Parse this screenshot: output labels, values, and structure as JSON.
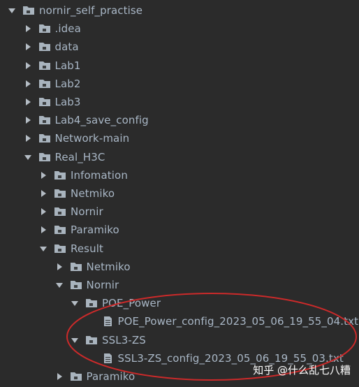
{
  "tree": [
    {
      "label": "nornir_self_practise",
      "type": "folder",
      "expanded": true,
      "depth": 0,
      "icon": "folder-icon"
    },
    {
      "label": ".idea",
      "type": "folder",
      "expanded": false,
      "depth": 1,
      "icon": "folder-icon"
    },
    {
      "label": "data",
      "type": "folder",
      "expanded": false,
      "depth": 1,
      "icon": "folder-icon"
    },
    {
      "label": "Lab1",
      "type": "folder",
      "expanded": false,
      "depth": 1,
      "icon": "folder-icon"
    },
    {
      "label": "Lab2",
      "type": "folder",
      "expanded": false,
      "depth": 1,
      "icon": "folder-icon"
    },
    {
      "label": "Lab3",
      "type": "folder",
      "expanded": false,
      "depth": 1,
      "icon": "folder-icon"
    },
    {
      "label": "Lab4_save_config",
      "type": "folder",
      "expanded": false,
      "depth": 1,
      "icon": "folder-icon"
    },
    {
      "label": "Network-main",
      "type": "folder",
      "expanded": false,
      "depth": 1,
      "icon": "folder-icon"
    },
    {
      "label": "Real_H3C",
      "type": "folder",
      "expanded": true,
      "depth": 1,
      "icon": "folder-icon"
    },
    {
      "label": "Infomation",
      "type": "folder",
      "expanded": false,
      "depth": 2,
      "icon": "folder-icon"
    },
    {
      "label": "Netmiko",
      "type": "folder",
      "expanded": false,
      "depth": 2,
      "icon": "folder-icon"
    },
    {
      "label": "Nornir",
      "type": "folder",
      "expanded": false,
      "depth": 2,
      "icon": "folder-icon"
    },
    {
      "label": "Paramiko",
      "type": "folder",
      "expanded": false,
      "depth": 2,
      "icon": "folder-icon"
    },
    {
      "label": "Result",
      "type": "folder",
      "expanded": true,
      "depth": 2,
      "icon": "folder-icon"
    },
    {
      "label": "Netmiko",
      "type": "folder",
      "expanded": false,
      "depth": 3,
      "icon": "folder-icon"
    },
    {
      "label": "Nornir",
      "type": "folder",
      "expanded": true,
      "depth": 3,
      "icon": "folder-icon"
    },
    {
      "label": "POE_Power",
      "type": "folder",
      "expanded": true,
      "depth": 4,
      "icon": "folder-icon"
    },
    {
      "label": "POE_Power_config_2023_05_06_19_55_04.txt",
      "type": "file",
      "depth": 5,
      "icon": "text-file-icon"
    },
    {
      "label": "SSL3-ZS",
      "type": "folder",
      "expanded": true,
      "depth": 4,
      "icon": "folder-icon"
    },
    {
      "label": "SSL3-ZS_config_2023_05_06_19_55_03.txt",
      "type": "file",
      "depth": 5,
      "icon": "text-file-icon"
    },
    {
      "label": "Paramiko",
      "type": "folder",
      "expanded": false,
      "depth": 3,
      "icon": "folder-icon"
    }
  ],
  "watermark": "知乎 @什么乱七八糟",
  "colors": {
    "background": "#2b2b2b",
    "text": "#a9b7c6",
    "folder": "#a9b4be",
    "arrow": "#b4bcc4",
    "highlight_ellipse": "#cc2a2a"
  }
}
